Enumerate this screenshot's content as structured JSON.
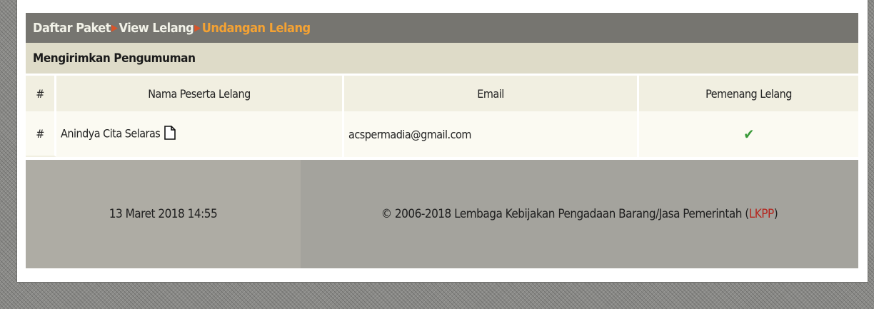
{
  "breadcrumb": {
    "items": [
      "Daftar Paket",
      "View Lelang",
      "Undangan Lelang"
    ]
  },
  "section": {
    "title": "Mengirimkan Pengumuman"
  },
  "table": {
    "headers": [
      "#",
      "Nama Peserta Lelang",
      "Email",
      "Pemenang Lelang"
    ],
    "rows": [
      {
        "hash": "#",
        "name": "Anindya Cita Selaras",
        "email": "acspermadia@gmail.com",
        "winner_icon": "checkmark-icon"
      }
    ]
  },
  "footer": {
    "datetime": "13 Maret 2018 14:55",
    "copyright_prefix": "© 2006-2018 Lembaga Kebijakan Pengadaan Barang/Jasa Pemerintah (",
    "copyright_link": "LKPP",
    "copyright_suffix": ")"
  },
  "colors": {
    "breadcrumb_bg": "#767570",
    "breadcrumb_current": "#f4a233",
    "separator": "#d7542a",
    "section_bg": "#dedbc8",
    "check": "#3a9a3a",
    "link": "#b5261e"
  }
}
